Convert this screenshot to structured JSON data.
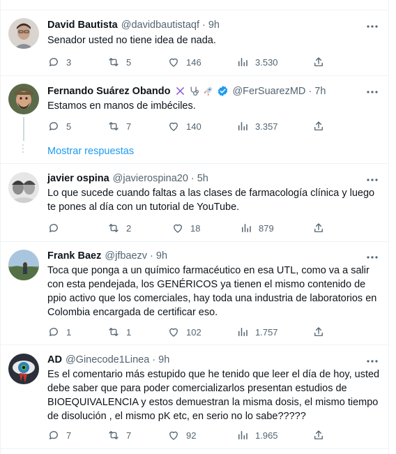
{
  "tweets": [
    {
      "name": "David Bautista",
      "handle": "@davidbautistaqf",
      "sep": "·",
      "time": "9h",
      "text": "Senador usted no tiene idea de nada.",
      "replies": "3",
      "retweets": "5",
      "likes": "146",
      "views": "3.530"
    },
    {
      "name": "Fernando Suárez Obando",
      "handle": "@FerSuarezMD",
      "sep": "·",
      "time": "7h",
      "text": "Estamos en manos de imbéciles.",
      "replies": "5",
      "retweets": "7",
      "likes": "140",
      "views": "3.357",
      "verified_color": "#1d9bf0"
    },
    {
      "name": "javier ospina",
      "handle": "@javierospina20",
      "sep": "·",
      "time": "5h",
      "text": "Lo que sucede cuando faltas a las clases de farmacología clínica y luego te pones al día con un tutorial de YouTube.",
      "replies": "",
      "retweets": "2",
      "likes": "18",
      "views": "879"
    },
    {
      "name": "Frank Baez",
      "handle": "@jfbaezv",
      "sep": "·",
      "time": "9h",
      "text": "Toca que ponga a un químico farmacéutico en esa UTL, como va a salir con esta pendejada, los GENÉRICOS ya tienen el mismo contenido de ppio activo que los comerciales, hay toda una industria de laboratorios en Colombia encargada de certificar eso.",
      "replies": "1",
      "retweets": "1",
      "likes": "102",
      "views": "1.757"
    },
    {
      "name": "AD",
      "handle": "@Ginecode1Linea",
      "sep": "·",
      "time": "9h",
      "text": "Es el comentario más estupido que he tenido que leer el día de hoy, usted debe saber que para poder comercializarlos presentan estudios de BIOEQUIVALENCIA y estos demuestran la misma dosis, el mismo tiempo de disolución , el mismo pK etc, en serio no lo sabe?????",
      "replies": "7",
      "retweets": "7",
      "likes": "92",
      "views": "1.965"
    }
  ],
  "show_replies": "Mostrar respuestas",
  "colors": {
    "accent": "#1d9bf0",
    "secondary_text": "#536471",
    "border": "#eff3f4"
  }
}
